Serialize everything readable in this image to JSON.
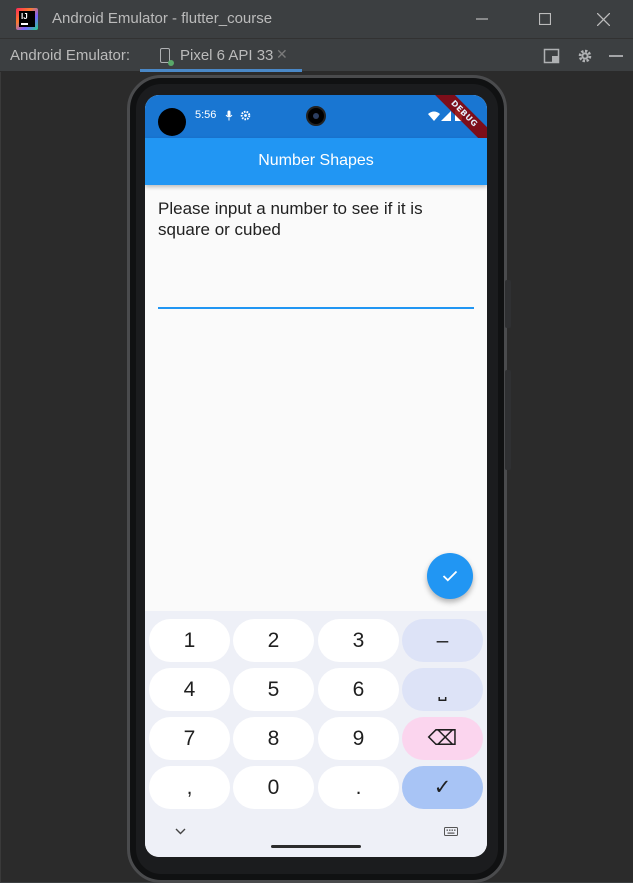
{
  "window": {
    "title": "Android Emulator - flutter_course"
  },
  "toolbar": {
    "label": "Android Emulator:",
    "device_tab": "Pixel 6 API 33",
    "close_glyph": "✕"
  },
  "status_bar": {
    "time": "5:56",
    "debug_banner": "DEBUG"
  },
  "app": {
    "title": "Number Shapes",
    "prompt": "Please input a number to see if it is square or cubed",
    "input_value": ""
  },
  "keyboard": {
    "keys": [
      "1",
      "2",
      "3",
      "–",
      "4",
      "5",
      "6",
      "⎵",
      "7",
      "8",
      "9",
      "⌫",
      ",",
      "0",
      ".",
      "✓"
    ]
  },
  "colors": {
    "status_bar": "#1976d2",
    "app_bar": "#2196f3",
    "fab": "#2196f3",
    "input_underline": "#2196f3",
    "key_function": "#dde3f7",
    "key_delete": "#fbd5ee",
    "key_confirm": "#a8c4f5"
  },
  "icons": {
    "fab": "check-icon",
    "status": [
      "mic-icon",
      "settings-gear-icon",
      "wifi-icon",
      "signal-icon",
      "battery-icon"
    ],
    "keyboard_footer": [
      "chevron-down-icon",
      "keyboard-icon"
    ]
  }
}
